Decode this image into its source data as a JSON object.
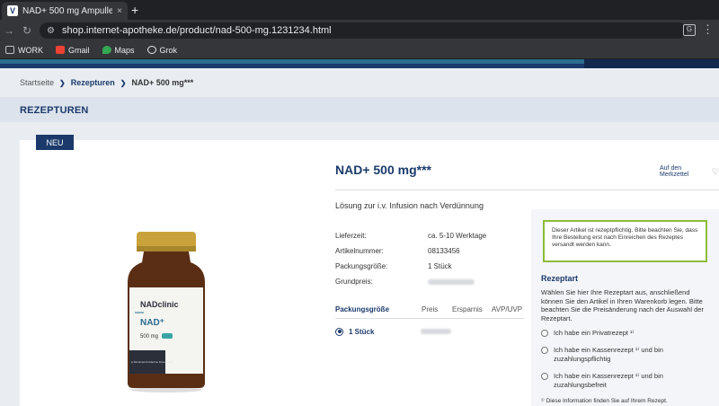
{
  "browser": {
    "tab_title": "NAD+ 500 mg Ampulle - Re...",
    "favicon_letter": "V",
    "tab_close": "×",
    "new_tab": "+",
    "url": "shop.internet-apotheke.de/product/nad-500-mg.1231234.html",
    "bookmarks": [
      {
        "label": "WORK",
        "icon": "folder-icon",
        "color": "#bdc1c6"
      },
      {
        "label": "Gmail",
        "icon": "gmail-icon",
        "color": "#ea4335"
      },
      {
        "label": "Maps",
        "icon": "maps-icon",
        "color": "#34a853"
      },
      {
        "label": "Grok",
        "icon": "grok-icon",
        "color": "#e8eaed"
      }
    ]
  },
  "breadcrumb": {
    "home": "Startseite",
    "category": "Rezepturen",
    "current": "NAD+ 500 mg***"
  },
  "section_title": "REZEPTUREN",
  "badge": "NEU",
  "product": {
    "title": "NAD+ 500 mg***",
    "wishlist": "Auf den Merkzettel",
    "subtitle": "Lösung zur i.v. Infusion nach Verdünnung",
    "details": [
      {
        "label": "Lieferzeit:",
        "value": "ca. 5-10 Werktage"
      },
      {
        "label": "Artikelnummer:",
        "value": "08133456"
      },
      {
        "label": "Packungsgröße:",
        "value": "1 Stück"
      },
      {
        "label": "Grundpreis:",
        "value": ""
      }
    ],
    "image": {
      "brand": "NADclinic",
      "name": "NAD⁺",
      "dose": "500 mg",
      "small_text": "β-Nicotinamid Adenine Dinucleotid"
    }
  },
  "price_table": {
    "headers": [
      "Packungsgröße",
      "Preis",
      "Ersparnis",
      "AVP/UVP"
    ],
    "rows": [
      {
        "size": "1 Stück",
        "selected": true
      }
    ]
  },
  "rezept": {
    "notice": "Dieser Artikel ist rezeptpflichtig. Bitte beachten Sie, dass Ihre Bestellung erst nach Einreichen des Rezeptes versandt werden kann.",
    "heading": "Rezeptart",
    "description": "Wählen Sie hier Ihre Rezeptart aus, anschließend können Sie den Artikel in Ihren Warenkorb legen. Bitte beachten Sie die Preisänderung nach der Auswahl der Rezeptart.",
    "options": [
      "Ich habe ein Privatrezept ¹⁾",
      "Ich habe ein Kassenrezept ¹⁾ und bin zuzahlungspflichtig",
      "Ich habe ein Kassenrezept ¹⁾ und bin zuzahlungsbefreit"
    ],
    "footnote": "¹⁾ Diese Information finden Sie auf Ihrem Rezept."
  },
  "colors": {
    "brand_navy": "#1b3a6b",
    "accent_green": "#8dbb3a"
  }
}
